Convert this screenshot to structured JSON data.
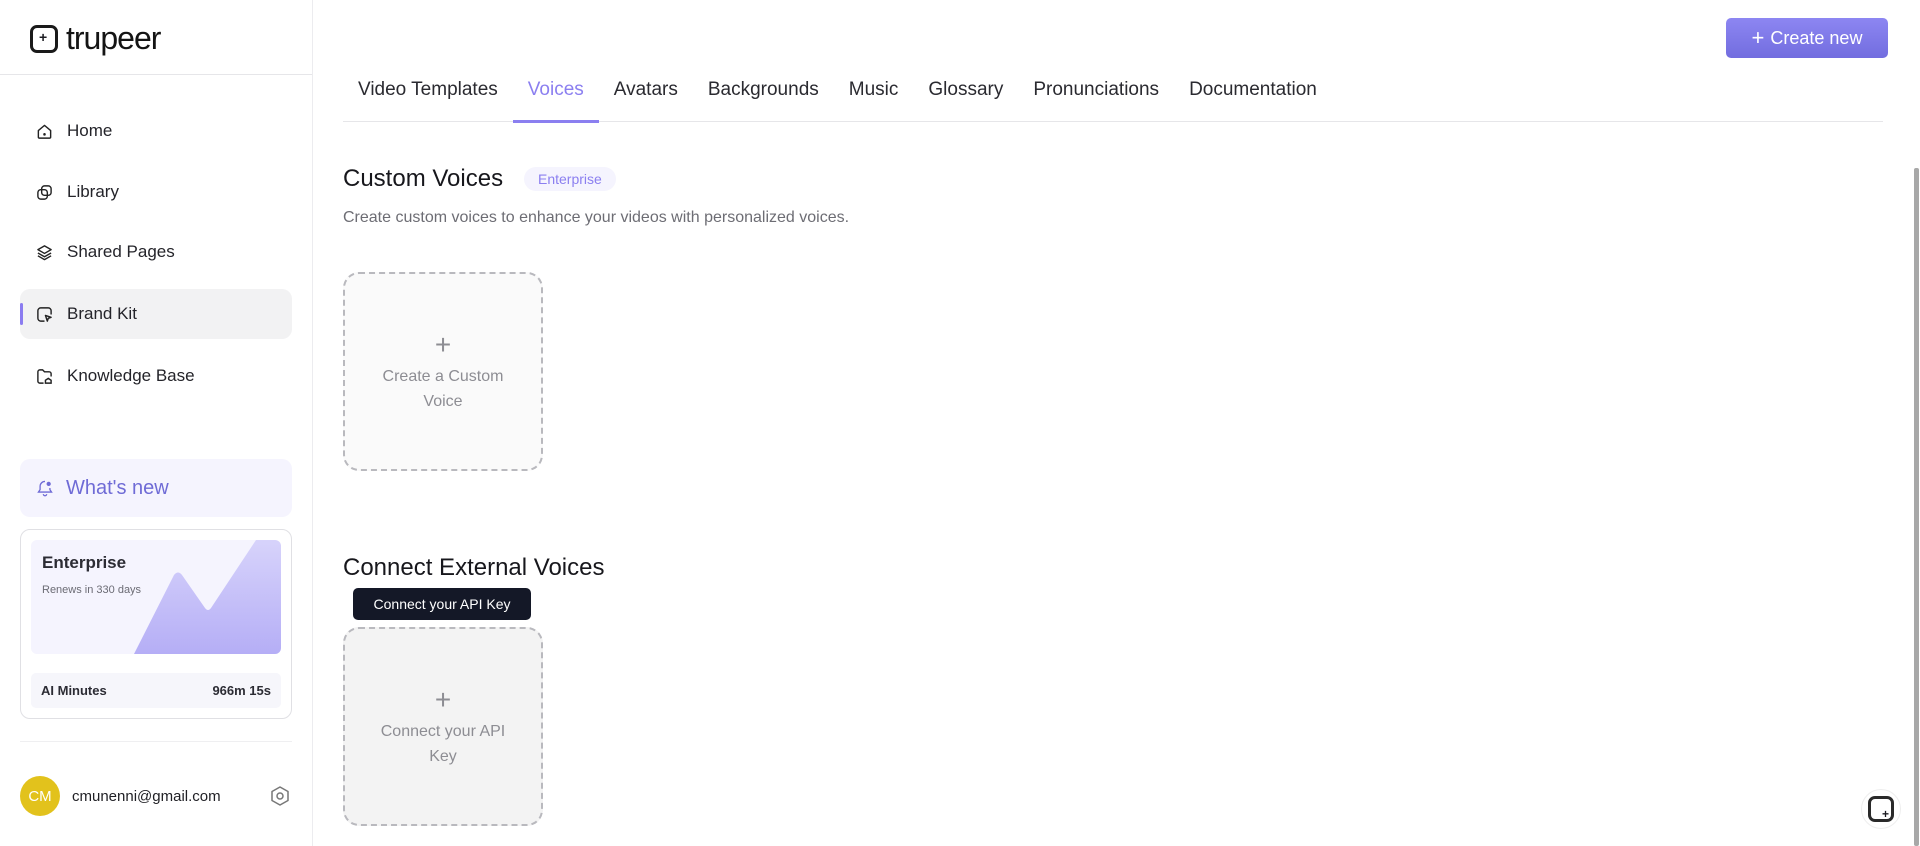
{
  "brand": {
    "name": "trupeer"
  },
  "sidebar": {
    "items": [
      {
        "label": "Home",
        "icon": "home-icon"
      },
      {
        "label": "Library",
        "icon": "library-icon"
      },
      {
        "label": "Shared Pages",
        "icon": "layers-icon"
      },
      {
        "label": "Brand Kit",
        "icon": "brand-kit-icon",
        "active": true
      },
      {
        "label": "Knowledge Base",
        "icon": "folder-icon"
      }
    ],
    "whats_new": "What's new",
    "plan": {
      "name": "Enterprise",
      "renews": "Renews in 330 days",
      "minutes_label": "AI Minutes",
      "minutes_value": "966m 15s"
    },
    "user": {
      "initials": "CM",
      "email": "cmunenni@gmail.com"
    }
  },
  "header": {
    "create_label": "Create new"
  },
  "tabs": [
    {
      "label": "Video Templates"
    },
    {
      "label": "Voices",
      "active": true
    },
    {
      "label": "Avatars"
    },
    {
      "label": "Backgrounds"
    },
    {
      "label": "Music"
    },
    {
      "label": "Glossary"
    },
    {
      "label": "Pronunciations"
    },
    {
      "label": "Documentation"
    }
  ],
  "custom": {
    "title": "Custom Voices",
    "badge": "Enterprise",
    "description": "Create custom voices to enhance your videos with personalized voices.",
    "card_line1": "Create a Custom",
    "card_line2": "Voice"
  },
  "external": {
    "title": "Connect External Voices",
    "tooltip": "Connect your API Key",
    "card_line1": "Connect your API",
    "card_line2": "Key"
  },
  "colors": {
    "accent": "#8b7ff0",
    "avatar": "#e2c21c",
    "tooltip": "#141827"
  }
}
